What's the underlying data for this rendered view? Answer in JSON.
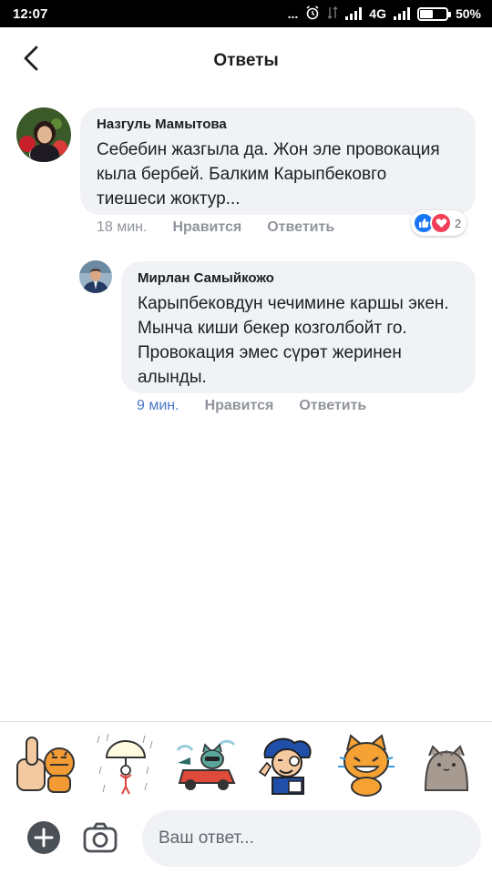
{
  "status_bar": {
    "time": "12:07",
    "dots": "...",
    "network": "4G",
    "battery": "50%",
    "battery_level": 0.5
  },
  "header": {
    "title": "Ответы",
    "back_icon": "chevron-left-icon"
  },
  "comment": {
    "author": "Назгуль Мамытова",
    "text": "Себебин жазгыла да. Жон эле провокация кыла бербей. Балким Карыпбековго тиешеси жоктур...",
    "time": "18 мин.",
    "like_label": "Нравится",
    "reply_label": "Ответить",
    "reactions": {
      "icons": [
        "like-icon",
        "love-icon"
      ],
      "count": "2"
    }
  },
  "reply": {
    "author": "Мирлан Самыйкожо",
    "text": "Карыпбековдун чечимине каршы экен. Мынча киши бекер козголбойт го. Провокация эмес сүрөт жеринен алынды.",
    "time": "9 мин.",
    "like_label": "Нравится",
    "reply_label": "Ответить"
  },
  "stickers": [
    "thumbs-up-tiger-sticker",
    "umbrella-rain-sticker",
    "cat-driving-car-sticker",
    "waving-boy-sticker",
    "happy-cat-sticker",
    "pusheen-cat-sticker"
  ],
  "composer": {
    "add_icon": "plus-circle-icon",
    "camera_icon": "camera-icon",
    "placeholder": "Ваш ответ..."
  },
  "colors": {
    "bubble": "#f0f2f5",
    "accent_time": "#4a76c7",
    "meta_gray": "#90949c",
    "like_blue": "#1877f2",
    "love_red": "#f33e58"
  }
}
